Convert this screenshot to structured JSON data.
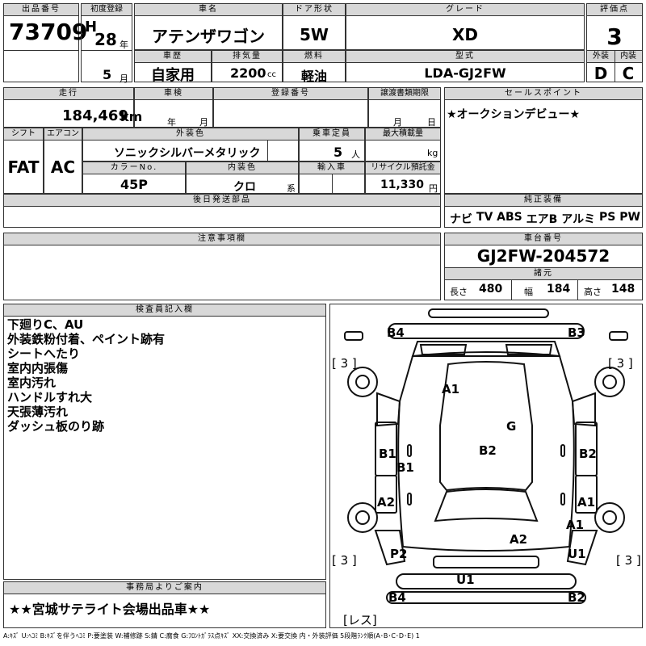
{
  "row1": {
    "lot_label": "出品番号",
    "lot_no": "73709",
    "reg_label": "初度登録",
    "era": "H",
    "year": "28",
    "year_unit": "年",
    "month": "5",
    "month_unit": "月",
    "name_label": "車名",
    "name": "アテンザワゴン",
    "door_label": "ドア形状",
    "door": "5W",
    "grade_label": "グレード",
    "grade": "XD",
    "score_label": "評価点",
    "score": "3",
    "history_label": "車歴",
    "history": "自家用",
    "disp_label": "排気量",
    "disp": "2200",
    "disp_unit": "cc",
    "fuel_label": "燃料",
    "fuel": "軽油",
    "model_label": "型式",
    "model": "LDA-GJ2FW",
    "ext_label": "外装",
    "ext": "D",
    "int_label": "内装",
    "int": "C"
  },
  "row2": {
    "mileage_label": "走行",
    "mileage": "184,469",
    "mileage_unit": "km",
    "inspect_label": "車検",
    "inspect_year": "年",
    "inspect_month": "月",
    "regno_label": "登録番号",
    "deadline_label": "譲渡書類期限",
    "deadline_month": "月",
    "deadline_day": "日",
    "shift_label": "シフト",
    "shift": "FAT",
    "ac_label": "エアコン",
    "ac": "AC",
    "color_label": "外装色",
    "color": "ソニックシルバーメタリック",
    "cap_label": "乗車定員",
    "cap": "5",
    "cap_unit": "人",
    "load_label": "最大積載量",
    "load_unit": "kg",
    "colorno_label": "カラーNo.",
    "colorno": "45P",
    "intcolor_label": "内装色",
    "intcolor": "クロ",
    "intcolor_unit": "系",
    "import_label": "輸入車",
    "recycle_label": "リサイクル預託金",
    "recycle": "11,330",
    "recycle_unit": "円",
    "later_label": "後日発送部品",
    "sales_label": "セールスポイント",
    "sales": "★オークションデビュー★",
    "equip_label": "純正装備",
    "equip": [
      "ナビ",
      "TV",
      "ABS",
      "エアB",
      "アルミ",
      "PS",
      "PW"
    ]
  },
  "row3": {
    "caution_label": "注意事項欄",
    "chassis_label": "車台番号",
    "chassis": "GJ2FW-204572",
    "spec_label": "諸元",
    "len_label": "長さ",
    "len": "480",
    "wid_label": "幅",
    "wid": "184",
    "hgt_label": "高さ",
    "hgt": "148"
  },
  "inspector": {
    "label": "検査員記入欄",
    "notes": [
      "下廻りC、AU",
      "外装鉄粉付着、ペイント跡有",
      "シートへたり",
      "室内内張傷",
      "室内汚れ",
      "ハンドルすれ大",
      "天張薄汚れ",
      "ダッシュ板のり跡"
    ]
  },
  "office": {
    "label": "事務局よりご案内",
    "text": "★★宮城サテライト会場出品車★★"
  },
  "diagram": {
    "brackets": [
      "[ 3 ]",
      "[ 3 ]",
      "[ 3 ]",
      "[ 3 ]",
      "[レス]"
    ],
    "marks": [
      "B4",
      "B3",
      "A1",
      "G",
      "B1",
      "B2",
      "B1",
      "B2",
      "A2",
      "A1",
      "A1",
      "A2",
      "P2",
      "U1",
      "U1",
      "B4",
      "B2"
    ]
  },
  "legend": "A:ｷｽﾞ U:ﾍｺﾐ B:ｷｽﾞを伴うﾍｺﾐ P:要塗装 W:補修跡 S:錆 C:腐食 G:ﾌﾛﾝﾄｶﾞﾗｽ点ｷｽﾞ XX:交換済み X:要交換 内・外装評価 5段階ﾗﾝｸ順(A･B･C･D･E) 1"
}
